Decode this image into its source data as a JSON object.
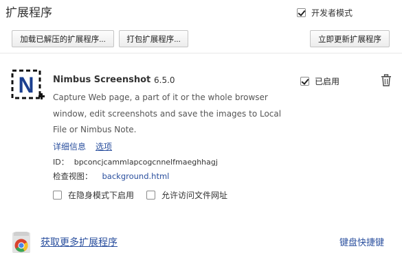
{
  "header": {
    "title": "扩展程序",
    "developer_mode_label": "开发者模式",
    "developer_mode_checked": true
  },
  "toolbar": {
    "load_unpacked_label": "加载已解压的扩展程序...",
    "pack_label": "打包扩展程序...",
    "update_now_label": "立即更新扩展程序"
  },
  "extension": {
    "name": "Nimbus Screenshot",
    "version": "6.5.0",
    "enabled_label": "已启用",
    "enabled_checked": true,
    "description": "Capture Web page, a part of it or the whole browser window, edit screenshots and save the images to Local File or Nimbus Note.",
    "details_link": "详细信息",
    "options_link": "选项",
    "id_label": "ID：",
    "id_value": "bpconcjcammlapcogcnnelfmaeghhagj",
    "views_label": "检查视图：",
    "views_link": "background.html",
    "incognito_label": "在隐身模式下启用",
    "incognito_checked": false,
    "file_urls_label": "允许访问文件网址",
    "file_urls_checked": false,
    "logo_letter": "N"
  },
  "footer": {
    "get_more_label": "获取更多扩展程序",
    "shortcuts_label": "键盘快捷键"
  },
  "colors": {
    "link": "#2a4f9e",
    "logo_blue": "#1b3f8f"
  }
}
